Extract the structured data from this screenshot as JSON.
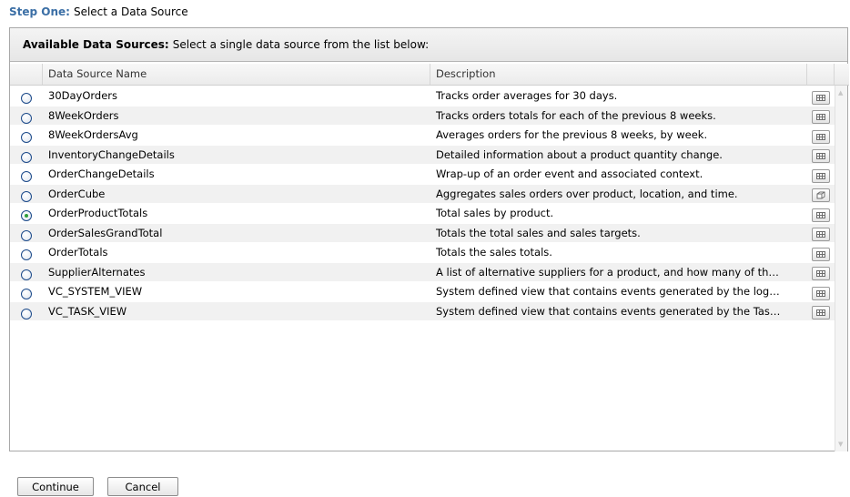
{
  "step": {
    "label": "Step One:",
    "text": "Select a Data Source"
  },
  "panel": {
    "header_bold": "Available Data Sources:",
    "header_text": "Select a single data source from the list below:"
  },
  "table": {
    "columns": [
      "",
      "Data Source Name",
      "Description",
      ""
    ],
    "rows": [
      {
        "name": "30DayOrders",
        "description": "Tracks order averages for 30 days.",
        "selected": false,
        "action_icon": "table-view-icon"
      },
      {
        "name": "8WeekOrders",
        "description": "Tracks orders totals for each of the previous 8 weeks.",
        "selected": false,
        "action_icon": "table-view-icon"
      },
      {
        "name": "8WeekOrdersAvg",
        "description": "Averages orders for the previous 8 weeks, by week.",
        "selected": false,
        "action_icon": "table-view-icon"
      },
      {
        "name": "InventoryChangeDetails",
        "description": "Detailed information about a product quantity change.",
        "selected": false,
        "action_icon": "table-view-icon"
      },
      {
        "name": "OrderChangeDetails",
        "description": "Wrap-up of an order event and associated context.",
        "selected": false,
        "action_icon": "table-view-icon"
      },
      {
        "name": "OrderCube",
        "description": "Aggregates sales orders over product, location, and time.",
        "selected": false,
        "action_icon": "cube-view-icon"
      },
      {
        "name": "OrderProductTotals",
        "description": "Total sales by product.",
        "selected": true,
        "action_icon": "table-view-icon"
      },
      {
        "name": "OrderSalesGrandTotal",
        "description": "Totals the total sales and sales targets.",
        "selected": false,
        "action_icon": "table-view-icon"
      },
      {
        "name": "OrderTotals",
        "description": "Totals the sales totals.",
        "selected": false,
        "action_icon": "table-view-icon"
      },
      {
        "name": "SupplierAlternates",
        "description": "A list of alternative suppliers for a product, and how many of th…",
        "selected": false,
        "action_icon": "table-view-icon"
      },
      {
        "name": "VC_SYSTEM_VIEW",
        "description": "System defined view that contains events generated by the log…",
        "selected": false,
        "action_icon": "table-view-icon"
      },
      {
        "name": "VC_TASK_VIEW",
        "description": "System defined view that contains events generated by the Tas…",
        "selected": false,
        "action_icon": "table-view-icon"
      }
    ]
  },
  "buttons": {
    "continue": "Continue",
    "cancel": "Cancel"
  },
  "colors": {
    "step_label": "#3a6ea5",
    "radio_selected": "#2f9e3a",
    "row_alt": "#f1f1f1"
  }
}
